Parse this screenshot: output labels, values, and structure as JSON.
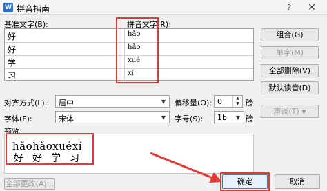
{
  "window": {
    "title": "拼音指南",
    "app_icon": "W"
  },
  "table": {
    "base_header": "基准文字(B):",
    "ruby_header": "拼音文字(R):",
    "rows": [
      {
        "base": "好",
        "ruby": "hǎo"
      },
      {
        "base": "好",
        "ruby": "hǎo"
      },
      {
        "base": "学",
        "ruby": "xué"
      },
      {
        "base": "习",
        "ruby": "xí"
      }
    ]
  },
  "buttons": {
    "group": "组合(G)",
    "single": "单字(M)",
    "clear_all": "全部删除(V)",
    "default_reading": "默认读音(D)",
    "tone": "声调(T)",
    "apply_all": "全部更改(A)...",
    "ok": "确定",
    "cancel": "取消"
  },
  "options": {
    "align_label": "对齐方式(L):",
    "align_value": "居中",
    "offset_label": "偏移量(O):",
    "offset_value": "0",
    "offset_unit": "磅",
    "font_label": "字体(F):",
    "font_value": "宋体",
    "size_label": "字号(S):",
    "size_value": "1b",
    "size_unit": "磅"
  },
  "preview": {
    "label": "预览",
    "pinyin": "hǎohǎoxuéxí",
    "chars": "好好学习"
  }
}
